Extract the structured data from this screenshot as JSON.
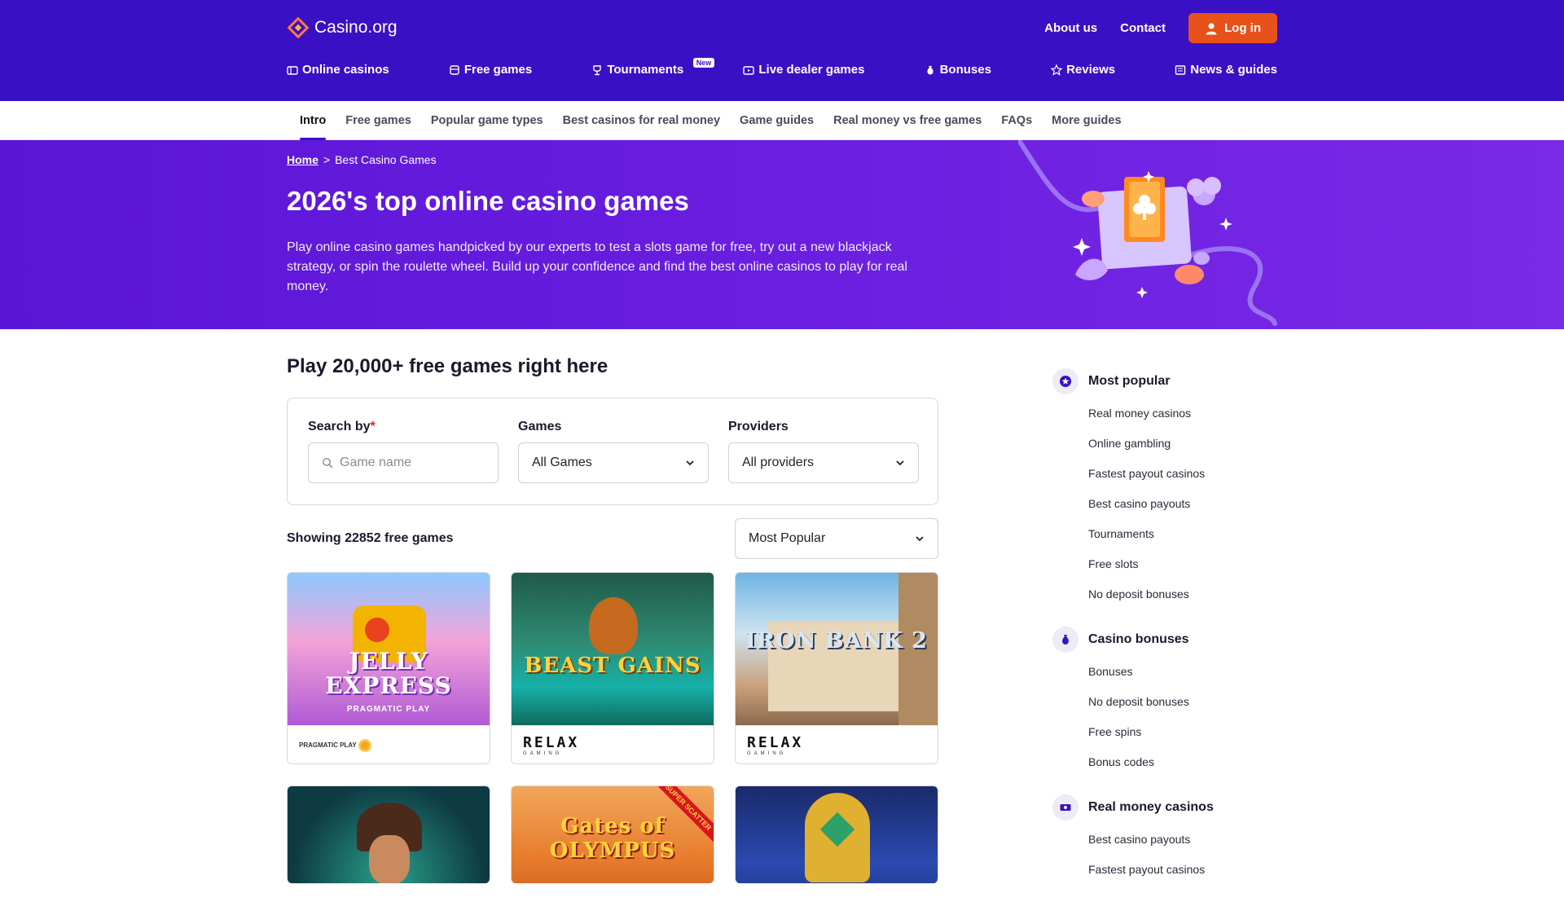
{
  "header": {
    "logo_text": "Casino.org",
    "about_label": "About us",
    "contact_label": "Contact",
    "login_label": "Log in",
    "nav": [
      {
        "label": "Online casinos",
        "icon": "casino-icon"
      },
      {
        "label": "Free games",
        "icon": "gamepad-icon"
      },
      {
        "label": "Tournaments",
        "icon": "trophy-icon",
        "badge": "New"
      },
      {
        "label": "Live dealer games",
        "icon": "tv-icon"
      },
      {
        "label": "Bonuses",
        "icon": "money-bag-icon"
      },
      {
        "label": "Reviews",
        "icon": "star-icon"
      },
      {
        "label": "News & guides",
        "icon": "newspaper-icon"
      }
    ],
    "colors": {
      "bg": "#3a10c4",
      "login": "#e8511a"
    }
  },
  "subnav": {
    "items": [
      "Intro",
      "Free games",
      "Popular game types",
      "Best casinos for real money",
      "Game guides",
      "Real money vs free games",
      "FAQs",
      "More guides"
    ],
    "active": "Intro"
  },
  "hero": {
    "breadcrumb_home": "Home",
    "breadcrumb_sep": ">",
    "breadcrumb_current": "Best Casino Games",
    "title": "2026's top online casino games",
    "description": "Play online casino games handpicked by our experts to test a slots game for free, try out a new blackjack strategy, or spin the roulette wheel. Build up your confidence and find the best online casinos to play for real money."
  },
  "games_section": {
    "title": "Play 20,000+ free games right here",
    "search_label": "Search by",
    "required_mark": "*",
    "search_placeholder": "Game name",
    "games_label": "Games",
    "games_value": "All Games",
    "providers_label": "Providers",
    "providers_value": "All providers",
    "results_text": "Showing 22852 free games",
    "sort_value": "Most Popular",
    "games": [
      {
        "title": "JELLY EXPRESS",
        "subtitle": "PRAGMATIC PLAY",
        "provider": "PRAGMATIC PLAY"
      },
      {
        "title": "BEAST GAINS",
        "subtitle": "",
        "provider": "RELAX",
        "provider_sub": "GAMING"
      },
      {
        "title": "IRON BANK 2",
        "subtitle": "",
        "provider": "RELAX",
        "provider_sub": "GAMING"
      },
      {
        "title": "",
        "subtitle": "",
        "provider": ""
      },
      {
        "title": "Gates of OLYMPUS",
        "subtitle": "",
        "provider": "",
        "ribbon": "SUPER SCATTER"
      },
      {
        "title": "",
        "subtitle": "",
        "provider": ""
      }
    ]
  },
  "sidebar": {
    "groups": [
      {
        "title": "Most popular",
        "icon": "star-badge-icon",
        "items": [
          "Real money casinos",
          "Online gambling",
          "Fastest payout casinos",
          "Best casino payouts",
          "Tournaments",
          "Free slots",
          "No deposit bonuses"
        ]
      },
      {
        "title": "Casino bonuses",
        "icon": "money-bag-icon",
        "items": [
          "Bonuses",
          "No deposit bonuses",
          "Free spins",
          "Bonus codes"
        ]
      },
      {
        "title": "Real money casinos",
        "icon": "cash-icon",
        "items": [
          "Best casino payouts",
          "Fastest payout casinos"
        ]
      }
    ]
  }
}
